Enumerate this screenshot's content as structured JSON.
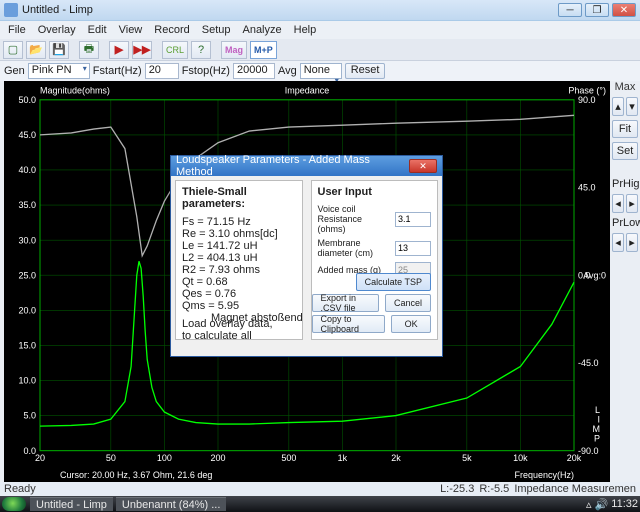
{
  "window": {
    "title": "Untitled - Limp"
  },
  "menu": [
    "File",
    "Overlay",
    "Edit",
    "View",
    "Record",
    "Setup",
    "Analyze",
    "Help"
  ],
  "toolbar": {
    "gen_label": "Gen",
    "gen_value": "Pink PN",
    "fstart_label": "Fstart(Hz)",
    "fstart": "20",
    "fstop_label": "Fstop(Hz)",
    "fstop": "20000",
    "avg_label": "Avg",
    "avg_value": "None",
    "reset": "Reset",
    "crl": "CRL",
    "mag": "Mag",
    "mp": "M+P"
  },
  "chart_data": {
    "type": "line",
    "title_left": "Magnitude(ohms)",
    "title_mid": "Impedance",
    "title_right": "Phase (°)",
    "xlabel": "Frequency(Hz)",
    "xscale": "log",
    "xlim": [
      20,
      20000
    ],
    "xticks": [
      20,
      50,
      100,
      200,
      500,
      1000,
      2000,
      5000,
      10000,
      20000
    ],
    "xtick_labels": [
      "20",
      "50",
      "100",
      "200",
      "500",
      "1k",
      "2k",
      "5k",
      "10k",
      "20k"
    ],
    "y1_label": "Magnitude (Ω)",
    "y1_lim": [
      0,
      50
    ],
    "y1_ticks": [
      0,
      5,
      10,
      15,
      20,
      25,
      30,
      35,
      40,
      45,
      50
    ],
    "y2_label": "Phase (°)",
    "y2_lim": [
      -90,
      90
    ],
    "y2_ticks": [
      -90,
      -45,
      0,
      45,
      90
    ],
    "series": [
      {
        "name": "Impedance (Ω)",
        "axis": "y1",
        "color": "#00ff00",
        "x": [
          20,
          30,
          40,
          50,
          60,
          65,
          68,
          70,
          72,
          74,
          76,
          78,
          80,
          85,
          90,
          100,
          120,
          150,
          200,
          300,
          500,
          1000,
          2000,
          5000,
          10000,
          15000,
          20000
        ],
        "values": [
          3.5,
          3.6,
          3.8,
          4.5,
          7,
          12,
          20,
          25,
          27,
          26,
          22,
          17,
          13,
          9,
          7,
          5.5,
          4.5,
          4,
          3.8,
          3.8,
          4,
          4.2,
          5,
          7.5,
          12,
          18,
          24
        ]
      },
      {
        "name": "Phase (°)",
        "axis": "y2",
        "color": "#b0b0b0",
        "x": [
          20,
          30,
          40,
          50,
          60,
          70,
          75,
          80,
          90,
          100,
          120,
          150,
          200,
          300,
          500,
          1000,
          2000,
          5000,
          10000,
          20000
        ],
        "values": [
          72,
          73,
          75,
          76,
          65,
          30,
          10,
          15,
          28,
          38,
          50,
          60,
          68,
          74,
          76,
          77,
          78,
          79,
          80,
          82
        ]
      }
    ],
    "cursor_text": "Cursor: 20.00 Hz, 3.67 Ohm, 21.6 deg",
    "avg_marker": "Avg:0",
    "side_marks": [
      "L",
      "I",
      "M",
      "P"
    ]
  },
  "sidecol": {
    "max": "Max",
    "fit": "Fit",
    "set": "Set",
    "prhigh": "PrHigh",
    "prlow": "PrLow"
  },
  "dialog": {
    "title": "Loudspeaker Parameters - Added Mass Method",
    "left": {
      "heading": "Thiele-Small parameters:",
      "lines": [
        "Fs  = 71.15 Hz",
        "Re  = 3.10 ohms[dc]",
        "Le  = 141.72 uH",
        "L2  = 404.13 uH",
        "R2  = 7.93 ohms",
        "Qt  = 0.68",
        "Qes = 0.76",
        "Qms = 5.95"
      ],
      "hint1": "Load overlay data,",
      "hint2": "to calculate all parameters!"
    },
    "right": {
      "heading": "User Input",
      "vcr_label": "Voice coil Resistance (ohms)",
      "vcr": "3.1",
      "diam_label": "Membrane diameter (cm)",
      "diam": "13",
      "mass_label": "Added mass (g)",
      "mass": "25",
      "calc": "Calculate TSP",
      "export": "Export in .CSV file",
      "copy": "Copy to Clipboard",
      "cancel": "Cancel",
      "ok": "OK"
    },
    "annotation": "Magnet abstoßend"
  },
  "status": {
    "ready": "Ready",
    "l": "L:-25.3",
    "r": "R:-5.5",
    "mode": "Impedance Measuremen"
  },
  "taskbar": {
    "t1": "Untitled - Limp",
    "t2": "Unbenannt (84%) ...",
    "time": "11:32"
  }
}
